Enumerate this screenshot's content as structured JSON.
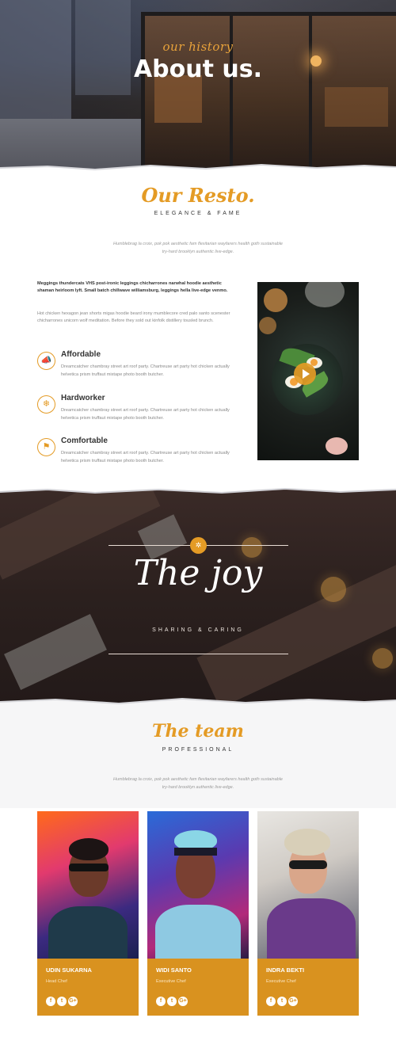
{
  "hero": {
    "subtitle": "our history",
    "title": "About us."
  },
  "resto": {
    "title": "Our Resto.",
    "subtitle": "ELEGANCE & FAME",
    "description": "Humblebrag la croix, pok pok aesthetic fam flexitarian wayfarers health goth sustainable try-hard brooklyn authentic live-edge.",
    "lead_bold": "Meggings thundercats VHS post-ironic leggings chicharrones narwhal hoodie aesthetic shaman heirloom lyft. Small batch chillwave williamsburg, leggings hella live-edge venmo.",
    "lead_para": "Hot chicken hexagon jean shorts migas hoodie beard irony mumblecore cred palo santo scenester chicharrones unicorn wolf meditation. Before they sold out kinfolk distillery tousled brunch.",
    "features": [
      {
        "icon": "horn-icon",
        "glyph": "📣",
        "title": "Affordable",
        "text": "Dreamcatcher chambray street art roof party. Chartreuse art party hot chicken actually helvetica prism truffaut mixtape photo booth butcher."
      },
      {
        "icon": "snowflake-icon",
        "glyph": "❄",
        "title": "Hardworker",
        "text": "Dreamcatcher chambray street art roof party. Chartreuse art party hot chicken actually helvetica prism truffaut mixtape photo booth butcher."
      },
      {
        "icon": "flag-icon",
        "glyph": "⚑",
        "title": "Comfortable",
        "text": "Dreamcatcher chambray street art roof party. Chartreuse art party hot chicken actually helvetica prism truffaut mixtape photo booth butcher."
      }
    ]
  },
  "joy": {
    "title": "The joy",
    "subtitle": "SHARING & CARING",
    "emblem": "✲"
  },
  "team": {
    "title": "The team",
    "subtitle": "PROFESSIONAL",
    "description": "Humblebrag la croix, pok pok aesthetic fam flexitarian wayfarers health goth sustainable try-hard brooklyn authentic live-edge.",
    "members": [
      {
        "name": "UDIN SUKARNA",
        "role": "Head Chef"
      },
      {
        "name": "WIDI SANTO",
        "role": "Executive Chef"
      },
      {
        "name": "INDRA BEKTI",
        "role": "Executive Chef"
      }
    ],
    "social": {
      "facebook": "f",
      "twitter": "t",
      "google": "G+"
    }
  },
  "colors": {
    "accent": "#e49b25",
    "card": "#d9921f",
    "dark_band": "#2b201e"
  }
}
